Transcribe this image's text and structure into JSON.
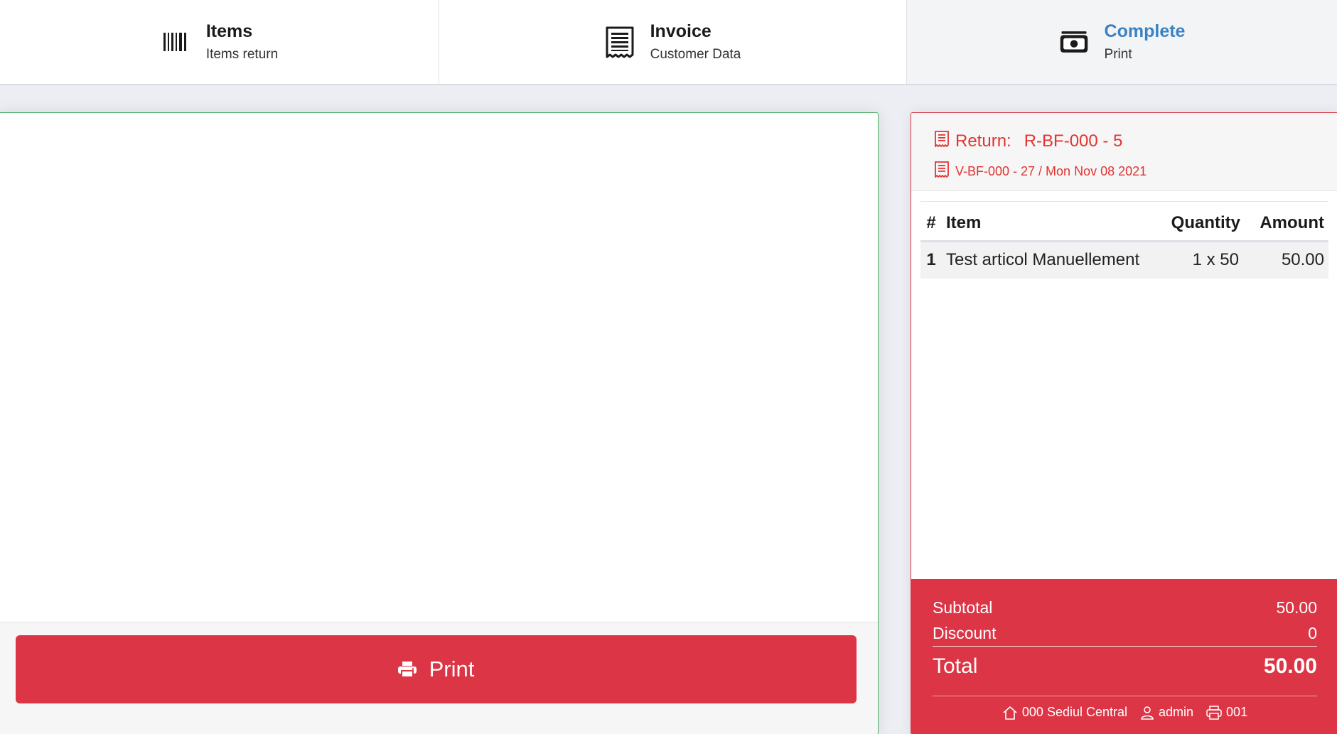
{
  "steps": [
    {
      "title": "Items",
      "subtitle": "Items return",
      "icon": "barcode-icon"
    },
    {
      "title": "Invoice",
      "subtitle": "Customer Data",
      "icon": "receipt-icon"
    },
    {
      "title": "Complete",
      "subtitle": "Print",
      "icon": "money-icon",
      "active": true
    }
  ],
  "print_button": {
    "label": "Print",
    "icon": "printer-icon"
  },
  "receipt": {
    "return_label": "Return:",
    "return_number": "R-BF-000 - 5",
    "invoice_ref": "V-BF-000 - 27 / Mon Nov 08 2021",
    "columns": {
      "num": "#",
      "item": "Item",
      "quantity": "Quantity",
      "amount": "Amount"
    },
    "rows": [
      {
        "num": "1",
        "item": "Test articol Manuellement",
        "quantity": "1 x 50",
        "amount": "50.00"
      }
    ],
    "subtotal_label": "Subtotal",
    "subtotal_value": "50.00",
    "discount_label": "Discount",
    "discount_value": "0",
    "total_label": "Total",
    "total_value": "50.00",
    "location": "000 Sediul Central",
    "user": "admin",
    "register": "001"
  },
  "colors": {
    "danger": "#dc3545",
    "active_step": "#3b82c4",
    "success_border": "#4caf66"
  }
}
